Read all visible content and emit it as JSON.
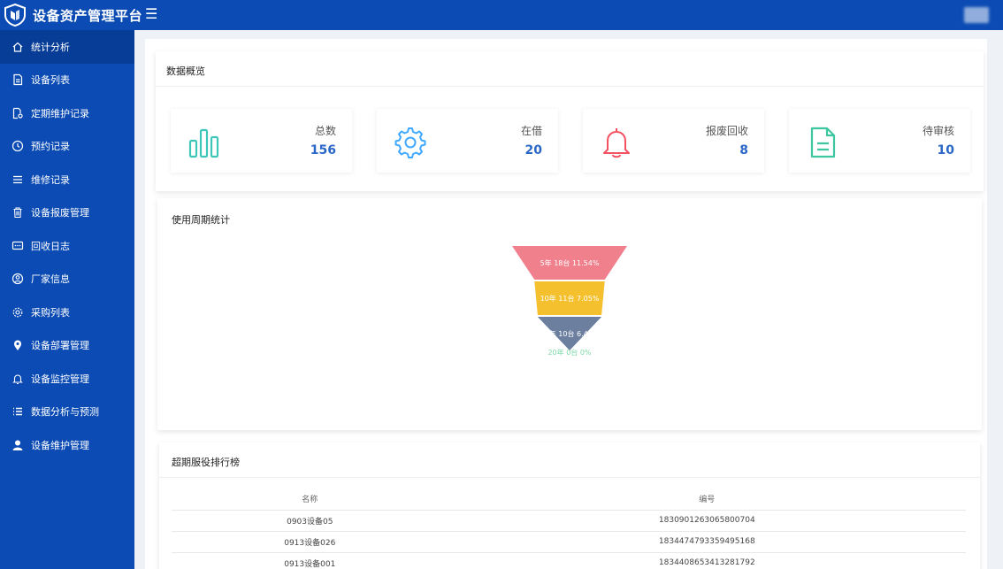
{
  "app": {
    "title": "设备资产管理平台"
  },
  "sidebar": {
    "items": [
      {
        "label": "统计分析",
        "icon": "home-icon"
      },
      {
        "label": "设备列表",
        "icon": "document-icon"
      },
      {
        "label": "定期维护记录",
        "icon": "file-settings-icon"
      },
      {
        "label": "预约记录",
        "icon": "clock-icon"
      },
      {
        "label": "维修记录",
        "icon": "menu-lines-icon"
      },
      {
        "label": "设备报废管理",
        "icon": "trash-icon"
      },
      {
        "label": "回收日志",
        "icon": "chat-icon"
      },
      {
        "label": "厂家信息",
        "icon": "user-circle-icon"
      },
      {
        "label": "采购列表",
        "icon": "gear-icon"
      },
      {
        "label": "设备部署管理",
        "icon": "location-pin-icon"
      },
      {
        "label": "设备监控管理",
        "icon": "bell-icon"
      },
      {
        "label": "数据分析与预测",
        "icon": "list-icon"
      },
      {
        "label": "设备维护管理",
        "icon": "person-icon"
      }
    ],
    "active_index": 0
  },
  "overview": {
    "title": "数据概览",
    "stats": [
      {
        "label": "总数",
        "value": "156",
        "icon": "bar-chart-icon",
        "color": "#3ec6b9"
      },
      {
        "label": "在借",
        "value": "20",
        "icon": "gear-icon",
        "color": "#40a9ff"
      },
      {
        "label": "报废回收",
        "value": "8",
        "icon": "bell-icon",
        "color": "#f5505f"
      },
      {
        "label": "待审核",
        "value": "10",
        "icon": "document-icon",
        "color": "#3ec6a0"
      }
    ]
  },
  "lifecycle": {
    "title": "使用周期统计",
    "chart_data": {
      "type": "funnel",
      "stages": [
        {
          "label": "5年 18台 11.54%",
          "value": 11.54,
          "color": "#f0808c"
        },
        {
          "label": "10年 11台 7.05%",
          "value": 7.05,
          "color": "#f5c02e"
        },
        {
          "label": "15年 10台 6.41%",
          "value": 6.41,
          "color": "#6c7f9f"
        },
        {
          "label": "20年 0台 0%",
          "value": 0,
          "color": "#7ed9a8"
        }
      ]
    }
  },
  "ranking": {
    "title": "超期服役排行榜",
    "columns": [
      "名称",
      "编号"
    ],
    "rows": [
      [
        "0903设备05",
        "1830901263065800704"
      ],
      [
        "0913设备026",
        "1834474793359495168"
      ],
      [
        "0913设备001",
        "1834408653413281792"
      ]
    ]
  }
}
